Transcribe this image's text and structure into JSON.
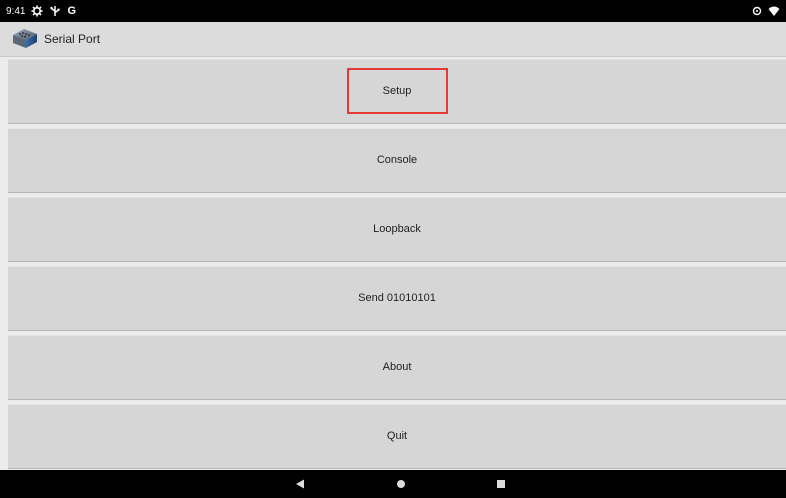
{
  "status_bar": {
    "time": "9:41",
    "left_icons": [
      "gear-icon",
      "usb-icon"
    ],
    "g_label": "G",
    "right_icons": [
      "sync-icon",
      "wifi-icon"
    ]
  },
  "action_bar": {
    "title": "Serial Port",
    "icon": "serial-port-icon"
  },
  "menu": {
    "items": [
      {
        "label": "Setup",
        "highlighted": true
      },
      {
        "label": "Console",
        "highlighted": false
      },
      {
        "label": "Loopback",
        "highlighted": false
      },
      {
        "label": "Send 01010101",
        "highlighted": false
      },
      {
        "label": "About",
        "highlighted": false
      },
      {
        "label": "Quit",
        "highlighted": false
      }
    ]
  },
  "nav_bar": {
    "buttons": [
      "back-icon",
      "home-icon",
      "recents-icon"
    ]
  },
  "colors": {
    "highlight_border": "#e53935",
    "button_bg": "#d6d6d6",
    "status_bar_bg": "#000000"
  }
}
